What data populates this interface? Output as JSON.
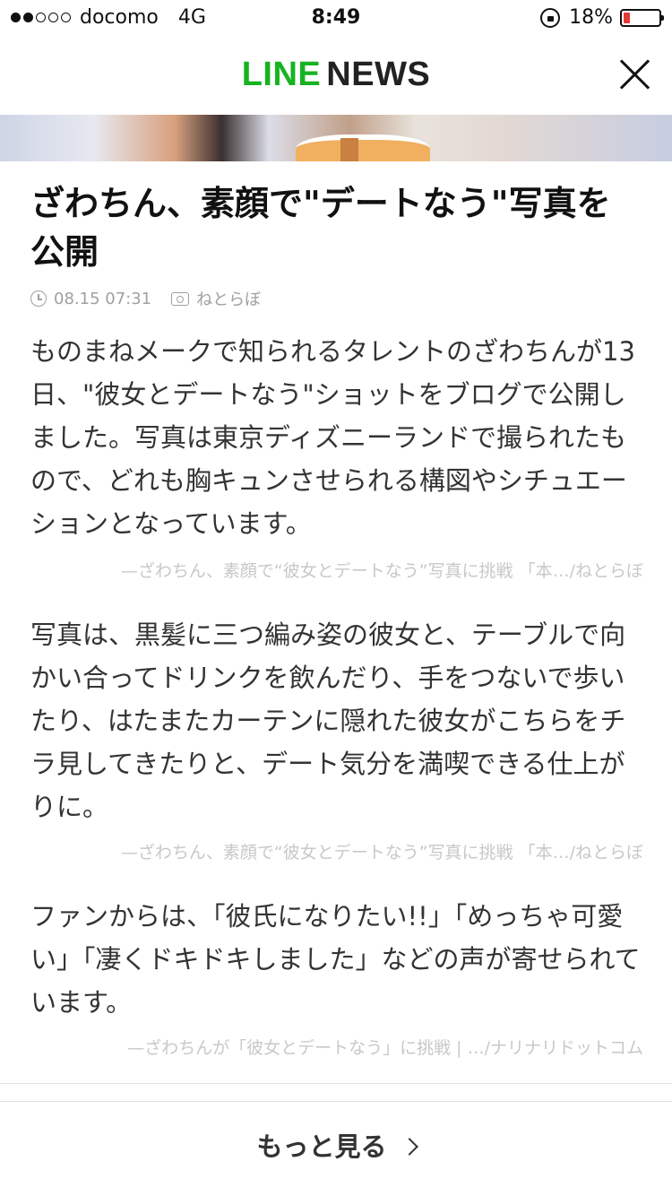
{
  "status_bar": {
    "carrier": "docomo",
    "network": "4G",
    "time": "8:49",
    "battery_percent_label": "18%",
    "battery_level": 0.18,
    "signal_bars_filled": 2,
    "signal_bars_total": 5
  },
  "header": {
    "logo_line": "LINE",
    "logo_news": "NEWS"
  },
  "article": {
    "title": "ざわちん、素顔で\"デートなう\"写真を公開",
    "date": "08.15 07:31",
    "source": "ねとらぼ",
    "paragraphs": [
      "ものまねメークで知られるタレントのざわちんが13日、\"彼女とデートなう\"ショットをブログで公開しました。写真は東京ディズニーランドで撮られたもので、どれも胸キュンさせられる構図やシチュエーションとなっています。",
      "写真は、黒髪に三つ編み姿の彼女と、テーブルで向かい合ってドリンクを飲んだり、手をつないで歩いたり、はたまたカーテンに隠れた彼女がこちらをチラ見してきたりと、デート気分を満喫できる仕上がりに。",
      "ファンからは、「彼氏になりたい!!」「めっちゃ可愛い」「凄くドキドキしました」などの声が寄せられています。"
    ],
    "sources": [
      "—ざわちん、素顔で“彼女とデートなう”写真に挑戦 「本…/ねとらぼ",
      "—ざわちん、素顔で“彼女とデートなう”写真に挑戦 「本…/ねとらぼ",
      "—ざわちんが「彼女とデートなう」に挑戦 | …/ナリナリドットコム"
    ]
  },
  "footer": {
    "more_label": "もっと見る"
  },
  "colors": {
    "line_green": "#17b321",
    "battery_low": "#e53935"
  }
}
